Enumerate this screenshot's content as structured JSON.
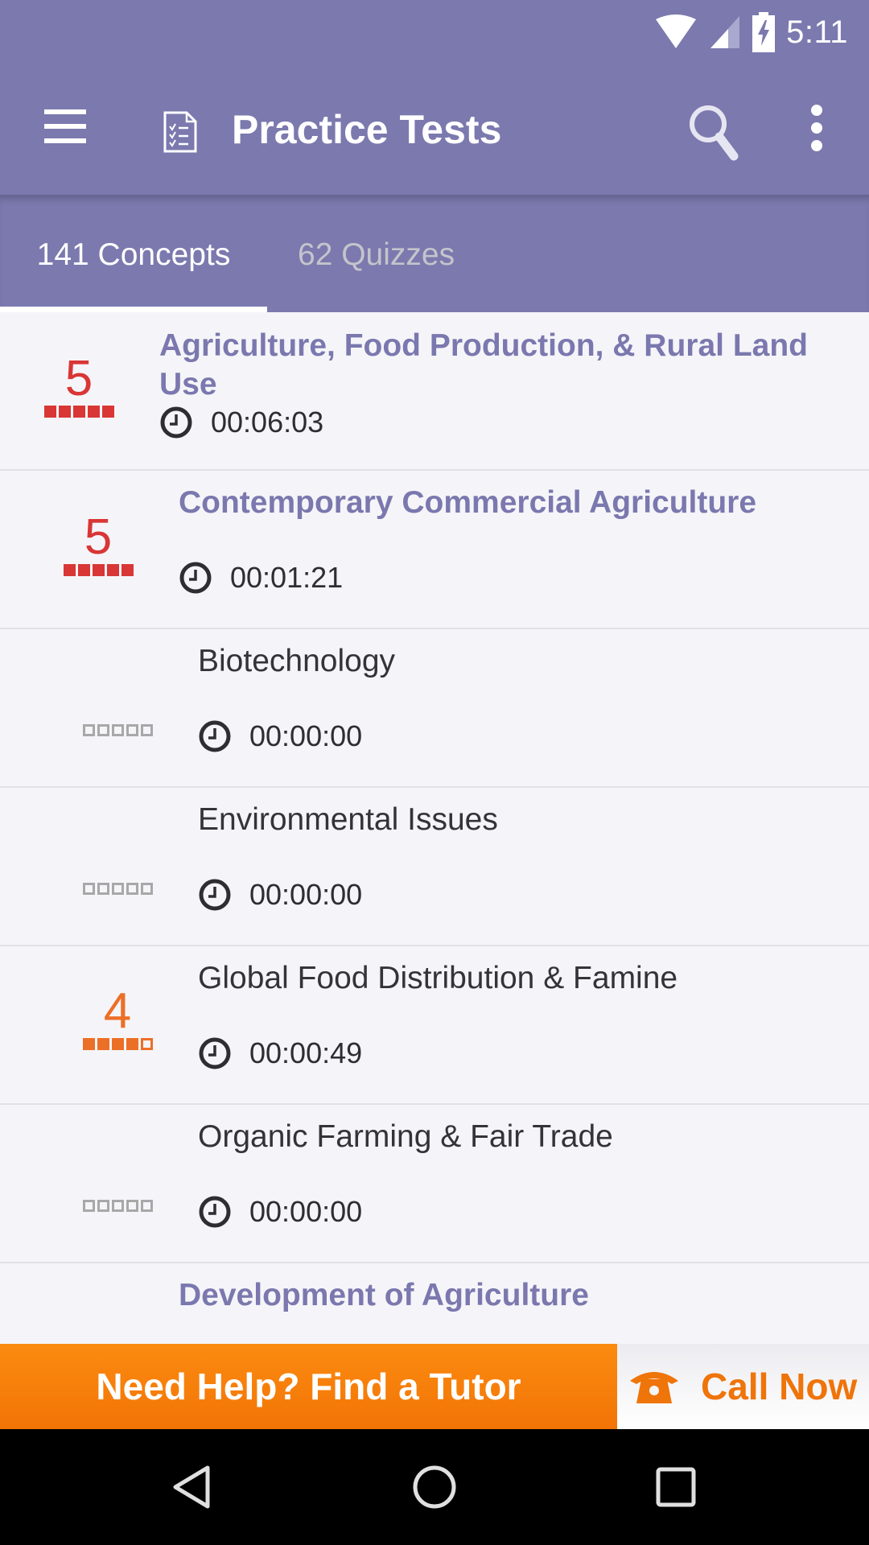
{
  "status_bar": {
    "time": "5:11",
    "icons": [
      "wifi-icon",
      "cell-signal-icon",
      "battery-charging-icon"
    ]
  },
  "app_bar": {
    "title": "Practice Tests",
    "icons": [
      "menu-icon",
      "document-checklist-icon",
      "search-icon",
      "more-vert-icon"
    ]
  },
  "tabs": [
    {
      "label": "141 Concepts",
      "selected": true
    },
    {
      "label": "62 Quizzes",
      "selected": false
    }
  ],
  "list": [
    {
      "title": "Agriculture, Food Production, & Rural Land Use",
      "type": "section",
      "score": "5",
      "score_filled": 5,
      "score_color": "#d93636",
      "time": "00:06:03"
    },
    {
      "title": "Contemporary Commercial Agriculture",
      "type": "section",
      "score": "5",
      "score_filled": 5,
      "score_color": "#d93636",
      "time": "00:01:21"
    },
    {
      "title": "Biotechnology",
      "type": "concept",
      "score": "",
      "score_filled": 0,
      "score_color": "#a8a8a8",
      "time": "00:00:00"
    },
    {
      "title": "Environmental Issues",
      "type": "concept",
      "score": "",
      "score_filled": 0,
      "score_color": "#a8a8a8",
      "time": "00:00:00"
    },
    {
      "title": "Global Food Distribution & Famine",
      "type": "concept",
      "score": "4",
      "score_filled": 4,
      "score_color": "#ec6f27",
      "time": "00:00:49"
    },
    {
      "title": "Organic Farming & Fair Trade",
      "type": "concept",
      "score": "",
      "score_filled": 0,
      "score_color": "#a8a8a8",
      "time": "00:00:00"
    },
    {
      "title": "Development of Agriculture",
      "type": "section"
    }
  ],
  "cta": {
    "tutor_label": "Need Help? Find a Tutor",
    "call_label": "Call Now"
  },
  "nav": {
    "icons": [
      "back-icon",
      "home-icon",
      "recents-icon"
    ]
  },
  "colors": {
    "primary": "#7b79ae",
    "accent_orange": "#f27406",
    "score_red": "#d93636",
    "score_orange": "#ec6f27"
  }
}
